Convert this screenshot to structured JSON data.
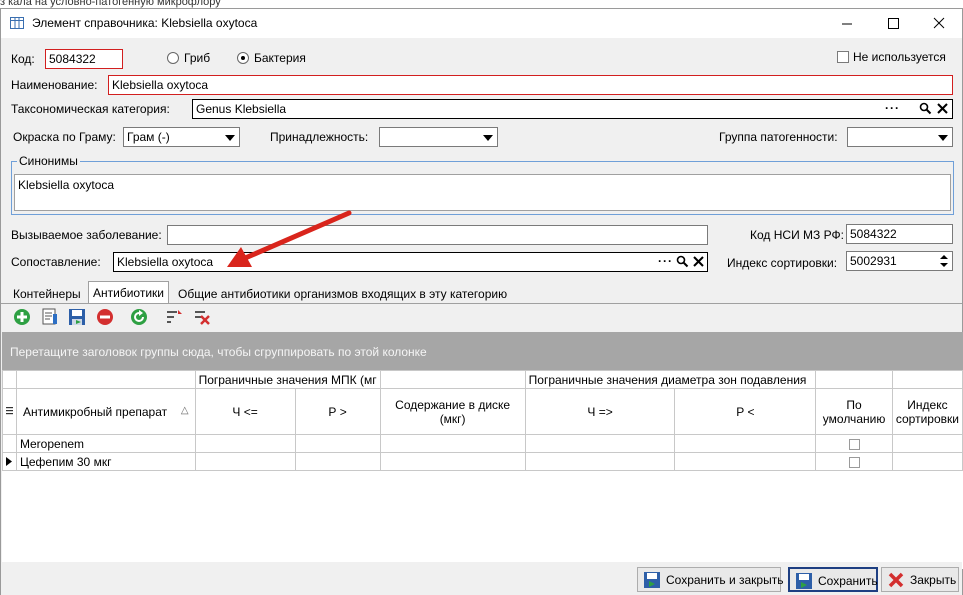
{
  "background_text": "з кала на условно-патогенную микрофлору",
  "window": {
    "title": "Элемент справочника: Klebsiella oxytoca",
    "minimize_icon": "minimize-icon",
    "maximize_icon": "maximize-icon",
    "close_icon": "close-icon"
  },
  "form": {
    "code_label": "Код:",
    "code_value": "5084322",
    "radio_fungus": "Гриб",
    "radio_bacteria": "Бактерия",
    "selected_radio": "Бактерия",
    "not_used_label": "Не используется",
    "name_label": "Наименование:",
    "name_value": "Klebsiella oxytoca",
    "taxon_label": "Таксономическая категория:",
    "taxon_value": "Genus Klebsiella",
    "picker_ellipsis": "···",
    "gram_label": "Окраска по Граму:",
    "gram_value": "Грам (-)",
    "affiliation_label": "Принадлежность:",
    "affiliation_value": "",
    "pathogenicity_label": "Группа патогенности:",
    "pathogenicity_value": "",
    "synonyms_label": "Синонимы",
    "synonyms_value": "Klebsiella oxytoca",
    "disease_label": "Вызываемое заболевание:",
    "disease_value": "",
    "nsi_label": "Код НСИ МЗ РФ:",
    "nsi_value": "5084322",
    "mapping_label": "Сопоставление:",
    "mapping_value": "Klebsiella oxytoca",
    "sort_label": "Индекс сортировки:",
    "sort_value": "5002931"
  },
  "tabs": [
    {
      "label": "Контейнеры"
    },
    {
      "label": "Антибиотики"
    },
    {
      "label": "Общие антибиотики организмов входящих в эту категорию"
    }
  ],
  "active_tab": "Антибиотики",
  "grid": {
    "group_hint": "Перетащите заголовок группы сюда, чтобы сгруппировать по этой колонке",
    "band_mic": "Пограничные значения МПК (мг",
    "band_zone": "Пограничные значения диаметра зон подавления",
    "col_drug": "Антимикробный препарат",
    "sort_glyph": "△",
    "col_s_le": "Ч <=",
    "col_r_gt": "Р >",
    "col_disk": "Содержание в диске (мкг)",
    "col_s_ge": "Ч =>",
    "col_r_lt": "Р <",
    "col_default": "По умолчанию",
    "col_sort": "Индекс сортировки",
    "rows": [
      {
        "drug": "Meropenem",
        "current": false
      },
      {
        "drug": "Цефепим 30 мкг",
        "current": true
      }
    ]
  },
  "buttons": {
    "save_close": "Сохранить и закрыть",
    "save": "Сохранить",
    "close": "Закрыть"
  },
  "colors": {
    "required_border": "#d21f1f",
    "group_border": "#6f9fd8",
    "arrow": "#d9251c",
    "group_bar": "#a6a6a6"
  }
}
